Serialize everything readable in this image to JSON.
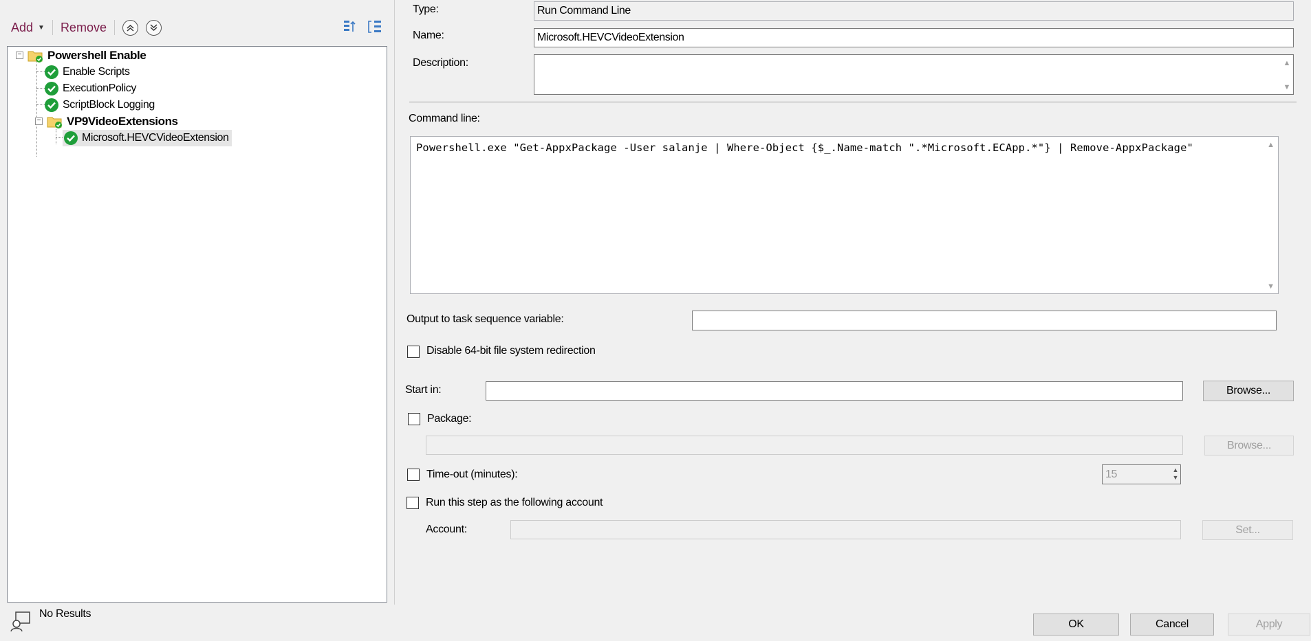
{
  "toolbar": {
    "add_label": "Add",
    "remove_label": "Remove"
  },
  "tree": {
    "items": [
      {
        "label": "Powershell Enable",
        "type": "group"
      },
      {
        "label": "Enable Scripts",
        "type": "step"
      },
      {
        "label": "ExecutionPolicy",
        "type": "step"
      },
      {
        "label": "ScriptBlock Logging",
        "type": "step"
      },
      {
        "label": "VP9VideoExtensions",
        "type": "group"
      },
      {
        "label": "Microsoft.HEVCVideoExtension",
        "type": "step",
        "selected": true
      }
    ]
  },
  "status": {
    "text": "No Results"
  },
  "properties": {
    "type_label": "Type:",
    "type_value": "Run Command Line",
    "name_label": "Name:",
    "name_value": "Microsoft.HEVCVideoExtension",
    "description_label": "Description:",
    "description_value": ""
  },
  "command": {
    "label": "Command line:",
    "value": "Powershell.exe \"Get-AppxPackage -User salanje | Where-Object {$_.Name-match \".*Microsoft.ECApp.*\"} | Remove-AppxPackage\""
  },
  "options": {
    "output_label": "Output to task sequence variable:",
    "output_value": "",
    "disable_redirect_label": "Disable 64-bit file system redirection",
    "start_in_label": "Start in:",
    "start_in_value": "",
    "browse_label": "Browse...",
    "package_label": "Package:",
    "package_value": "",
    "package_browse_label": "Browse...",
    "timeout_label": "Time-out (minutes):",
    "timeout_value": "15",
    "run_as_label": "Run this step as the following account",
    "account_label": "Account:",
    "account_value": "",
    "set_label": "Set..."
  },
  "dialog": {
    "ok_label": "OK",
    "cancel_label": "Cancel",
    "apply_label": "Apply"
  }
}
